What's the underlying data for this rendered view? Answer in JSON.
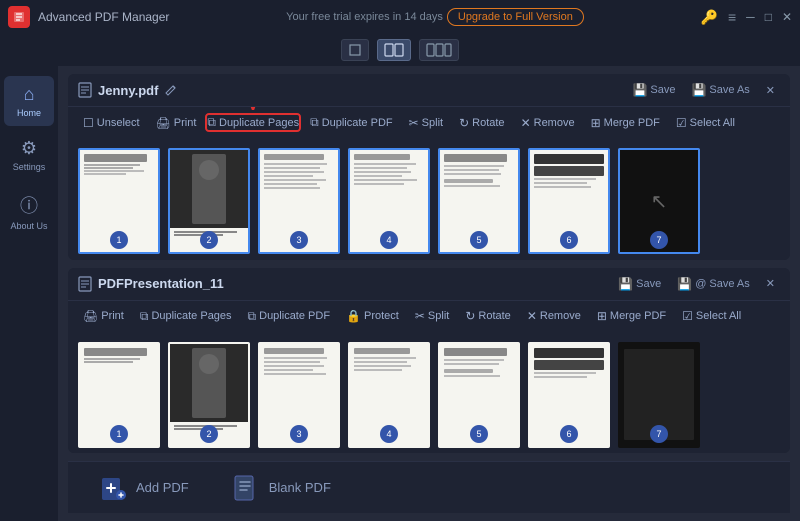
{
  "titleBar": {
    "appName": "Advanced PDF Manager",
    "trialText": "Your free trial expires in 14 days",
    "upgradeLabel": "Upgrade to Full Version",
    "appIconText": "A"
  },
  "sidebar": {
    "items": [
      {
        "id": "home",
        "label": "Home",
        "icon": "⌂",
        "active": true
      },
      {
        "id": "settings",
        "label": "Settings",
        "icon": "⚙",
        "active": false
      },
      {
        "id": "about",
        "label": "About Us",
        "icon": "ⓘ",
        "active": false
      }
    ]
  },
  "pdf1": {
    "filename": "Jenny.pdf",
    "toolbar": {
      "buttons": [
        {
          "id": "unselect",
          "label": "Unselect",
          "icon": "☐"
        },
        {
          "id": "print",
          "label": "Print",
          "icon": "🖨"
        },
        {
          "id": "duplicate-pages",
          "label": "Duplicate Pages",
          "icon": "⧉",
          "highlighted": true
        },
        {
          "id": "duplicate-pdf",
          "label": "Duplicate PDF",
          "icon": "⧉"
        },
        {
          "id": "split",
          "label": "Split",
          "icon": "✂"
        },
        {
          "id": "rotate",
          "label": "Rotate",
          "icon": "↻"
        },
        {
          "id": "remove",
          "label": "Remove",
          "icon": "✕"
        },
        {
          "id": "merge-pdf",
          "label": "Merge PDF",
          "icon": "⊞"
        },
        {
          "id": "select-all",
          "label": "Select All",
          "icon": "☑"
        }
      ]
    },
    "actions": {
      "save": "Save",
      "saveAs": "Save As"
    },
    "pages": [
      1,
      2,
      3,
      4,
      5,
      6,
      7
    ]
  },
  "pdf2": {
    "filename": "PDFPresentation_11",
    "toolbar": {
      "buttons": [
        {
          "id": "print",
          "label": "Print",
          "icon": "🖨"
        },
        {
          "id": "duplicate-pages",
          "label": "Duplicate Pages",
          "icon": "⧉"
        },
        {
          "id": "duplicate-pdf",
          "label": "Duplicate PDF",
          "icon": "⧉"
        },
        {
          "id": "protect",
          "label": "Protect",
          "icon": "🔒"
        },
        {
          "id": "split",
          "label": "Split",
          "icon": "✂"
        },
        {
          "id": "rotate",
          "label": "Rotate",
          "icon": "↻"
        },
        {
          "id": "remove",
          "label": "Remove",
          "icon": "✕"
        },
        {
          "id": "merge-pdf",
          "label": "Merge PDF",
          "icon": "⊞"
        },
        {
          "id": "select-all",
          "label": "Select All",
          "icon": "☑"
        }
      ]
    },
    "actions": {
      "save": "Save",
      "saveAs": "@ Save As"
    },
    "pages": [
      1,
      2,
      3,
      4,
      5,
      6,
      7
    ]
  },
  "bottom": {
    "addPDFLabel": "Add PDF",
    "blankPDFLabel": "Blank PDF"
  }
}
